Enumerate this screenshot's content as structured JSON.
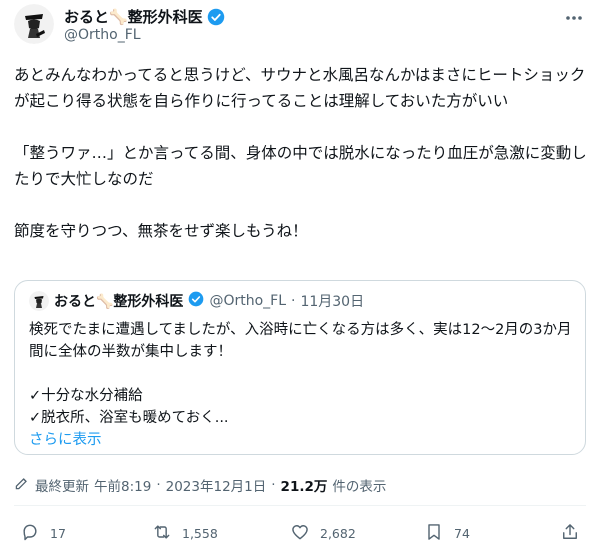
{
  "tweet": {
    "author_name": "おると🦴整形外科医",
    "author_handle": "@Ortho_FL",
    "more_icon": "ellipsis-icon",
    "paragraphs": [
      "あとみんなわかってると思うけど、サウナと水風呂なんかはまさにヒートショックが起こり得る状態を自ら作りに行ってることは理解しておいた方がいい",
      "「整うワァ…」とか言ってる間、身体の中では脱水になったり血圧が急激に変動したりで大忙しなのだ",
      "節度を守りつつ、無茶をせず楽しもうね！"
    ]
  },
  "quote": {
    "author_name": "おると🦴整形外科医",
    "author_handle": "@Ortho_FL",
    "separator": "·",
    "date": "11月30日",
    "line1": "検死でたまに遭遇してましたが、入浴時に亡くなる方は多く、実は12〜2月の3か月間に全体の半数が集中します！",
    "item1": "✓十分な水分補給",
    "item2": "✓脱衣所、浴室も暖めておく...",
    "show_more": "さらに表示"
  },
  "meta": {
    "edited_label": "最終更新",
    "time": "午前8:19",
    "sep1": "·",
    "date": "2023年12月1日",
    "sep2": "·",
    "views_count": "21.2万",
    "views_label": "件の表示"
  },
  "actions": {
    "reply_count": "17",
    "retweet_count": "1,558",
    "like_count": "2,682",
    "bookmark_count": "74"
  },
  "colors": {
    "accent": "#1d9bf0",
    "muted": "#536471",
    "text": "#0f1419",
    "border": "#cfd9de"
  }
}
